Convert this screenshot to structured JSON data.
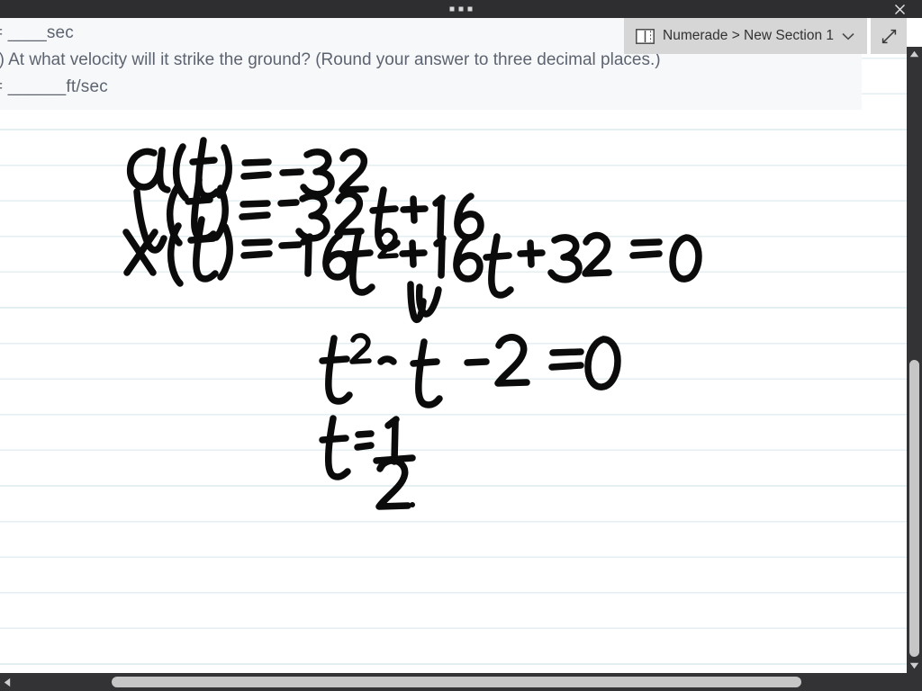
{
  "window": {
    "drag_handle": "three-dots",
    "close_label": "✕",
    "titlebar_color": "#2e2e30"
  },
  "notebook_selector": {
    "icon": "notebook-icon",
    "label": "Numerade > New Section 1",
    "chevron": "chevron-down-icon",
    "expand_icon": "expand-diagonal-icon",
    "background_color": "#d6d6d6"
  },
  "question": {
    "lines": [
      "= ____sec",
      "b) At what velocity will it strike the ground? (Round your answer to three decimal places.)",
      "= ______ft/sec"
    ],
    "text_color": "#5d6470",
    "background_color": "#f7f8fa"
  },
  "handwriting": {
    "description": "ink-notes",
    "lines": [
      "a(t) = -32",
      "v(t) = -32t + 16",
      "x(t) = -16t² + 16t + 32 = 0",
      "↙ (scribble mark)",
      "t² - t - 2 = 0",
      "t = 1/2"
    ],
    "ink_color": "#0b0b0b"
  },
  "page": {
    "rule_line_color": "#e3eff1",
    "rule_spacing_px": 39.6,
    "background_color": "#ffffff"
  },
  "scrollbars": {
    "vertical": {
      "track_color": "#333335",
      "thumb_color": "#c6c6c6",
      "up_arrow": "caret-up-icon",
      "down_arrow": "caret-down-icon"
    },
    "horizontal": {
      "track_color": "#333335",
      "thumb_color": "#c6c6c6",
      "left_arrow": "caret-left-icon",
      "right_arrow": "caret-right-icon"
    }
  }
}
